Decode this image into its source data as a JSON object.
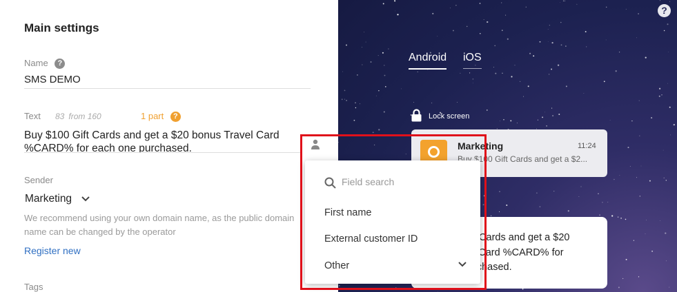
{
  "settings": {
    "title": "Main settings",
    "name_label": "Name",
    "name_value": "SMS DEMO",
    "text_label": "Text",
    "char_count": "83",
    "char_from": "from 160",
    "parts": "1 part",
    "text_value": "Buy $100 Gift Cards and get a $20 bonus Travel Card %CARD% for each one purchased.",
    "sender_label": "Sender",
    "sender_value": "Marketing",
    "sender_hint": "We recommend using your own domain name, as the public domain name can be changed by the operator",
    "register_link": "Register new",
    "tags_label": "Tags",
    "help_glyph": "?"
  },
  "preview": {
    "tabs": [
      {
        "label": "Android",
        "active": true
      },
      {
        "label": "iOS",
        "active": false
      }
    ],
    "lock_label": "Lock screen",
    "notification": {
      "title": "Marketing",
      "time": "11:24",
      "body": "Buy $100 Gift Cards and get a $2..."
    },
    "message_text": "Buy $100 Gift Cards and get a $20 bonus Travel Card  %CARD% for each one purchased.",
    "message_visible": "f Cards and get a $20 l Card  %CARD% for rchased.",
    "help_glyph": "?"
  },
  "dropdown": {
    "search_placeholder": "Field search",
    "items": [
      "First name",
      "External customer ID",
      "Other"
    ]
  },
  "colors": {
    "accent_orange": "#f0a030",
    "link_blue": "#2f6fc2",
    "highlight_red": "#e0101a",
    "preview_bg": "#1c2150"
  },
  "icons": {
    "help": "question-circle-icon",
    "person": "person-icon",
    "chevron": "chevron-down-icon",
    "lock": "lock-icon",
    "search": "search-icon",
    "app": "app-badge-icon"
  }
}
